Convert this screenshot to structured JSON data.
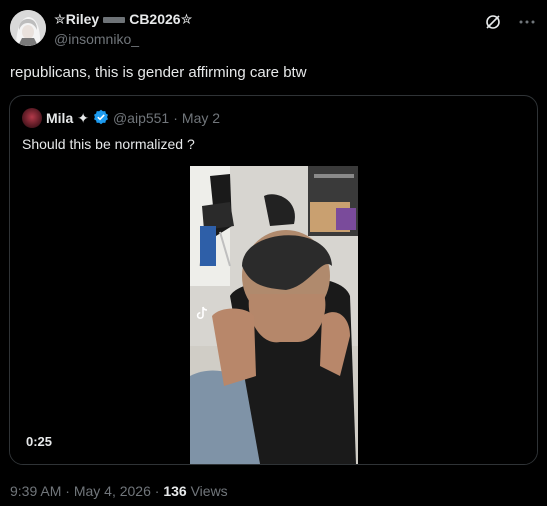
{
  "tweet": {
    "author": {
      "name_part1": "✮Riley",
      "name_part2": "CB2026✮",
      "handle": "@insomniko_"
    },
    "text": "republicans, this is gender affirming care btw",
    "quoted": {
      "name": "Mila",
      "name_suffix": "✦",
      "handle": "@aip551",
      "separator": "·",
      "date": "May 2",
      "text": "Should this be normalized ?",
      "video_duration": "0:25"
    },
    "time": "9:39 AM",
    "date": "May 4, 2026",
    "views_count": "136",
    "views_label": "Views"
  },
  "icons": {
    "grok": "grok-icon",
    "more": "more-icon",
    "verified": "verified-badge-icon",
    "tiktok": "tiktok-watermark-icon"
  },
  "colors": {
    "background": "#000000",
    "text": "#e7e9ea",
    "secondary": "#71767b",
    "border": "#2f3336",
    "verified": "#1d9bf0"
  }
}
